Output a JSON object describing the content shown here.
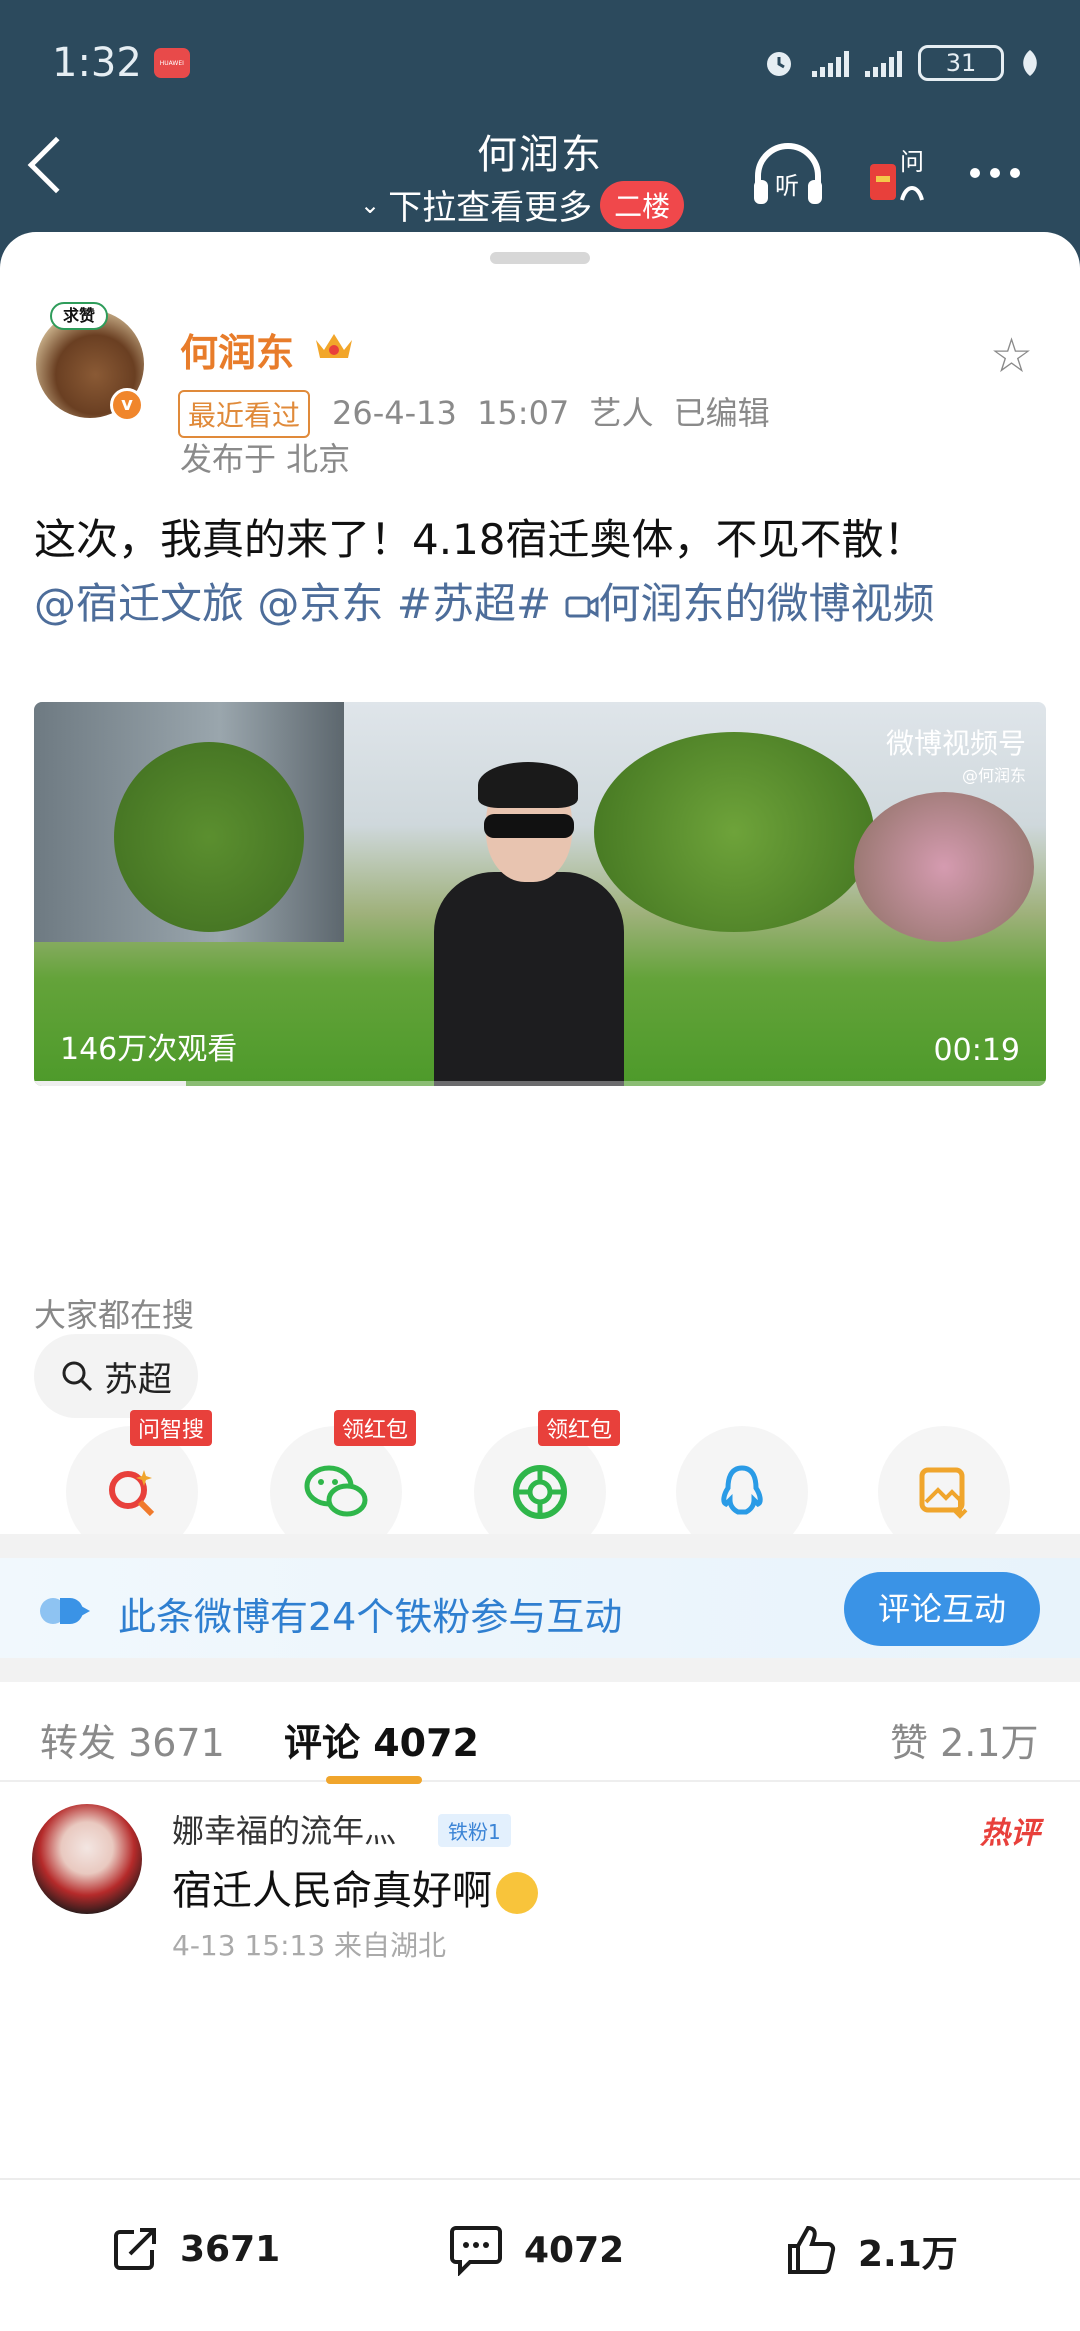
{
  "status": {
    "time": "1:32",
    "battery": "31"
  },
  "nav": {
    "title": "何润东",
    "subtitle": "下拉查看更多",
    "floor_badge": "二楼",
    "listen_label": "听",
    "ask_label": "问"
  },
  "post": {
    "author": "何润东",
    "avatar_tag": "求赞",
    "recent_badge": "最近看过",
    "datetime": "26-4-13 15:07",
    "role": "艺人",
    "edited": "已编辑",
    "location": "发布于 北京",
    "text_main": "这次，我真的来了！4.18宿迁奥体，不见不散！",
    "mention1": "@宿迁文旅",
    "mention2": "@京东",
    "hashtag": "#苏超#",
    "video_link": "何润东的微博视频",
    "video": {
      "logo": "微博视频号",
      "logo_sub": "@何润东",
      "views": "146万次观看",
      "duration": "00:19",
      "progress": 0.15
    }
  },
  "search": {
    "label": "大家都在搜",
    "chip": "苏超"
  },
  "share": [
    {
      "name": "wenzhisou",
      "tag": "问智搜",
      "color": "#e8403b"
    },
    {
      "name": "wechat",
      "tag": "领红包",
      "color": "#2fb64a"
    },
    {
      "name": "moments",
      "tag": "领红包",
      "color": "#2fb64a"
    },
    {
      "name": "qq",
      "tag": "",
      "color": "#2a9be6"
    },
    {
      "name": "save-image",
      "tag": "",
      "color": "#f0a52c"
    }
  ],
  "fans": {
    "text": "此条微博有24个铁粉参与互动",
    "button": "评论互动"
  },
  "tabs": {
    "repost": "转发 3671",
    "comment": "评论 4072",
    "like": "赞 2.1万"
  },
  "comment": {
    "name": "娜幸福的流年灬",
    "badge": "铁粉1",
    "hot": "热评",
    "text": "宿迁人民命真好啊",
    "meta": "4-13 15:13 来自湖北"
  },
  "bottom": {
    "repost": "3671",
    "comment": "4072",
    "like": "2.1万"
  }
}
